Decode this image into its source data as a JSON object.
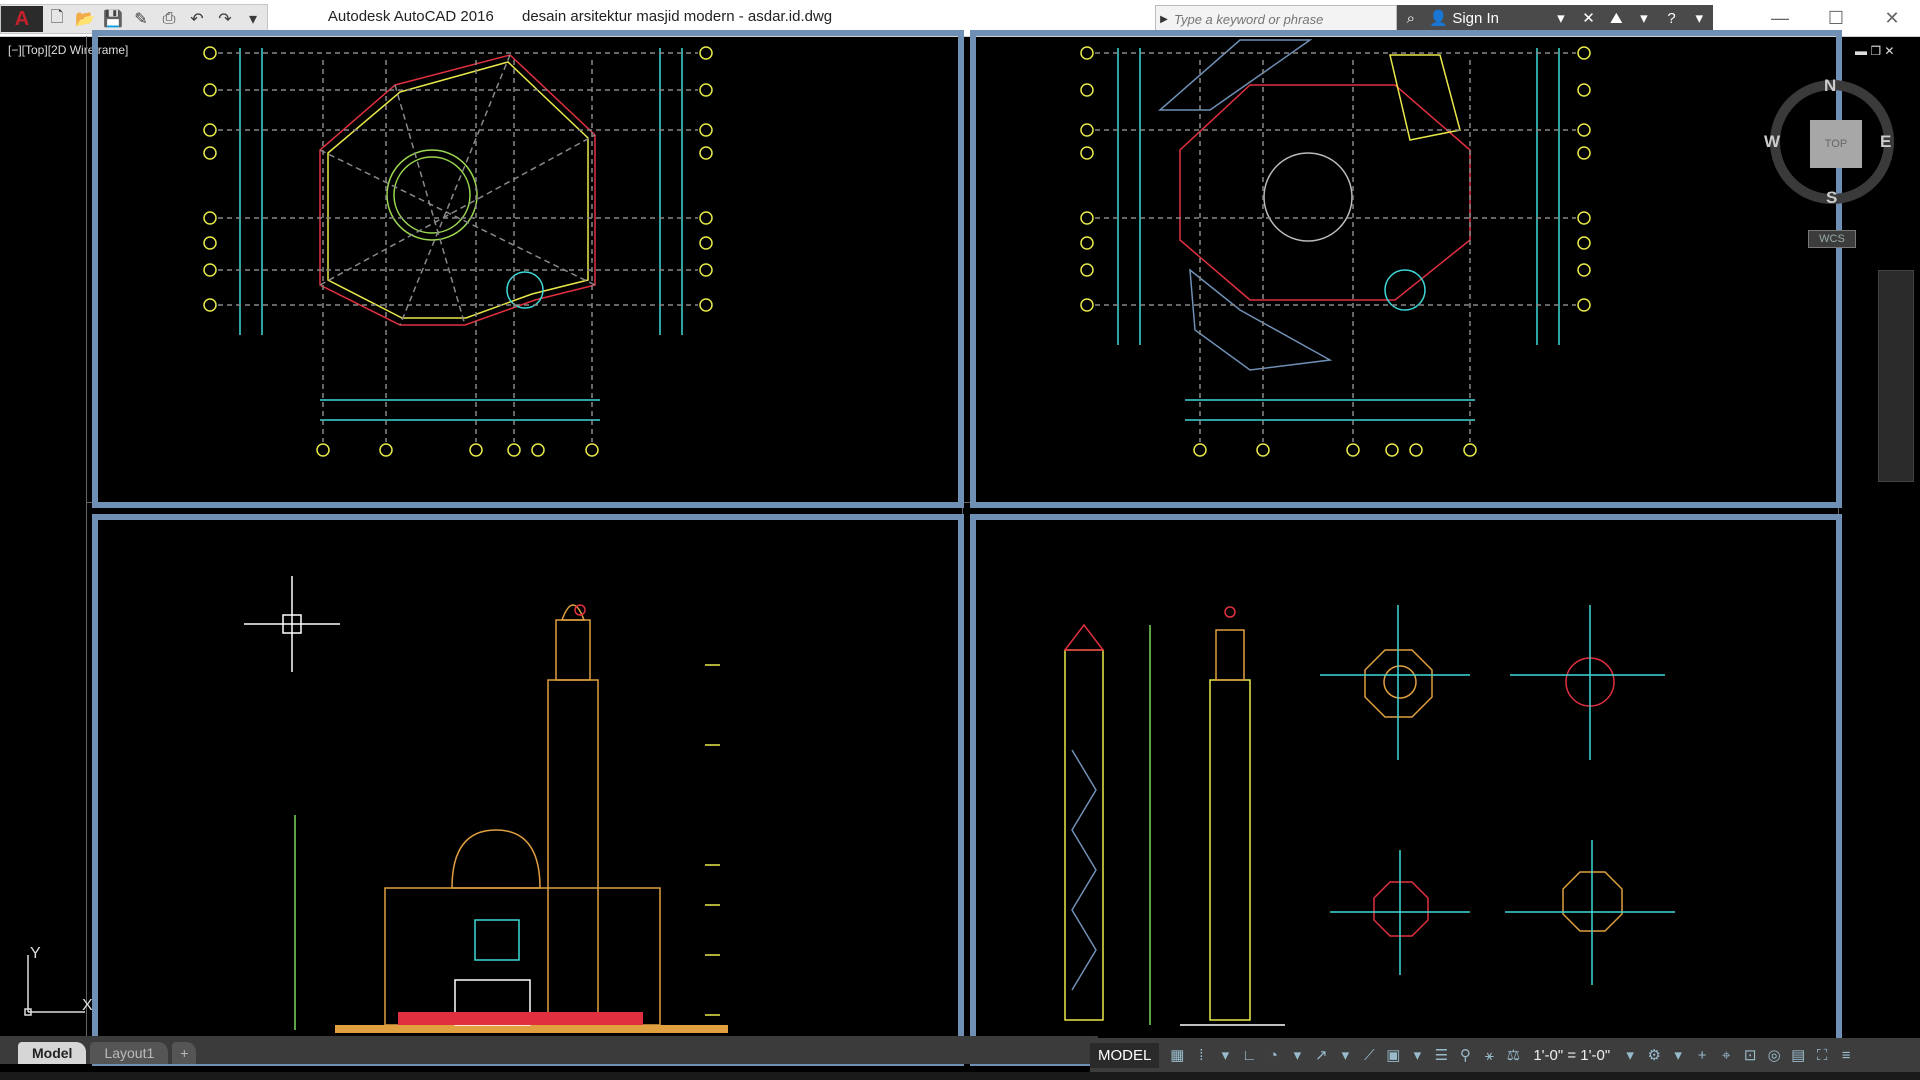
{
  "app": {
    "product": "Autodesk AutoCAD 2016",
    "document": "desain arsitektur masjid modern - asdar.id.dwg"
  },
  "search": {
    "placeholder": "Type a keyword or phrase"
  },
  "account": {
    "sign_in": "Sign In"
  },
  "viewport": {
    "label": "[−][Top][2D Wireframe]"
  },
  "viewcube": {
    "top": "TOP",
    "n": "N",
    "s": "S",
    "e": "E",
    "w": "W",
    "wcs": "WCS"
  },
  "ucs": {
    "y": "Y",
    "x": "X"
  },
  "tabs": {
    "model": "Model",
    "layout1": "Layout1",
    "add": "+"
  },
  "status": {
    "space": "MODEL",
    "scale": "1'-0\" = 1'-0\""
  },
  "colors": {
    "frame": "#6f8fb5",
    "cyan": "#3fd8d8",
    "yellow": "#e8e84a",
    "red": "#e03040",
    "green": "#7ad85a",
    "orange": "#e0a040"
  }
}
